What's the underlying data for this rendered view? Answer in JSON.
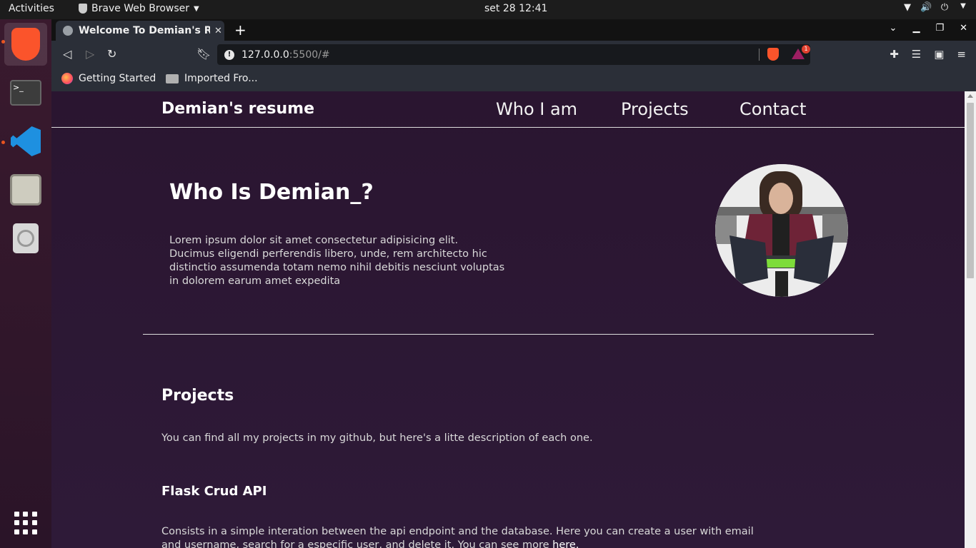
{
  "system": {
    "activities": "Activities",
    "app_name": "Brave Web Browser",
    "clock": "set 28  12:41"
  },
  "browser": {
    "tab_title": "Welcome To Demian's Res",
    "url_host": "127.0.0.0",
    "url_rest": ":5500/#",
    "rewards_badge": "1",
    "bookmarks": [
      "Getting Started",
      "Imported Fro..."
    ]
  },
  "site": {
    "brand": "Demian's resume",
    "nav": [
      "Who I am",
      "Projects",
      "Contact"
    ],
    "hero": {
      "title": "Who Is Demian_?",
      "text": "Lorem ipsum dolor sit amet consectetur adipisicing elit. Ducimus eligendi perferendis libero, unde, rem architecto hic distinctio assumenda totam nemo nihil debitis nesciunt voluptas in dolorem earum amet expedita"
    },
    "projects": {
      "title": "Projects",
      "description": "You can find all my projects in my github, but here's a litte description of each one.",
      "items": [
        {
          "title": "Flask Crud API",
          "text": "Consists in a simple interation between the api endpoint and the database. Here you can create a user with email and username, search for a especific user, and delete it. You can see more",
          "link": "here."
        }
      ]
    }
  },
  "colors": {
    "page_bg": "#2b1a35",
    "accent": "#fb542b"
  }
}
